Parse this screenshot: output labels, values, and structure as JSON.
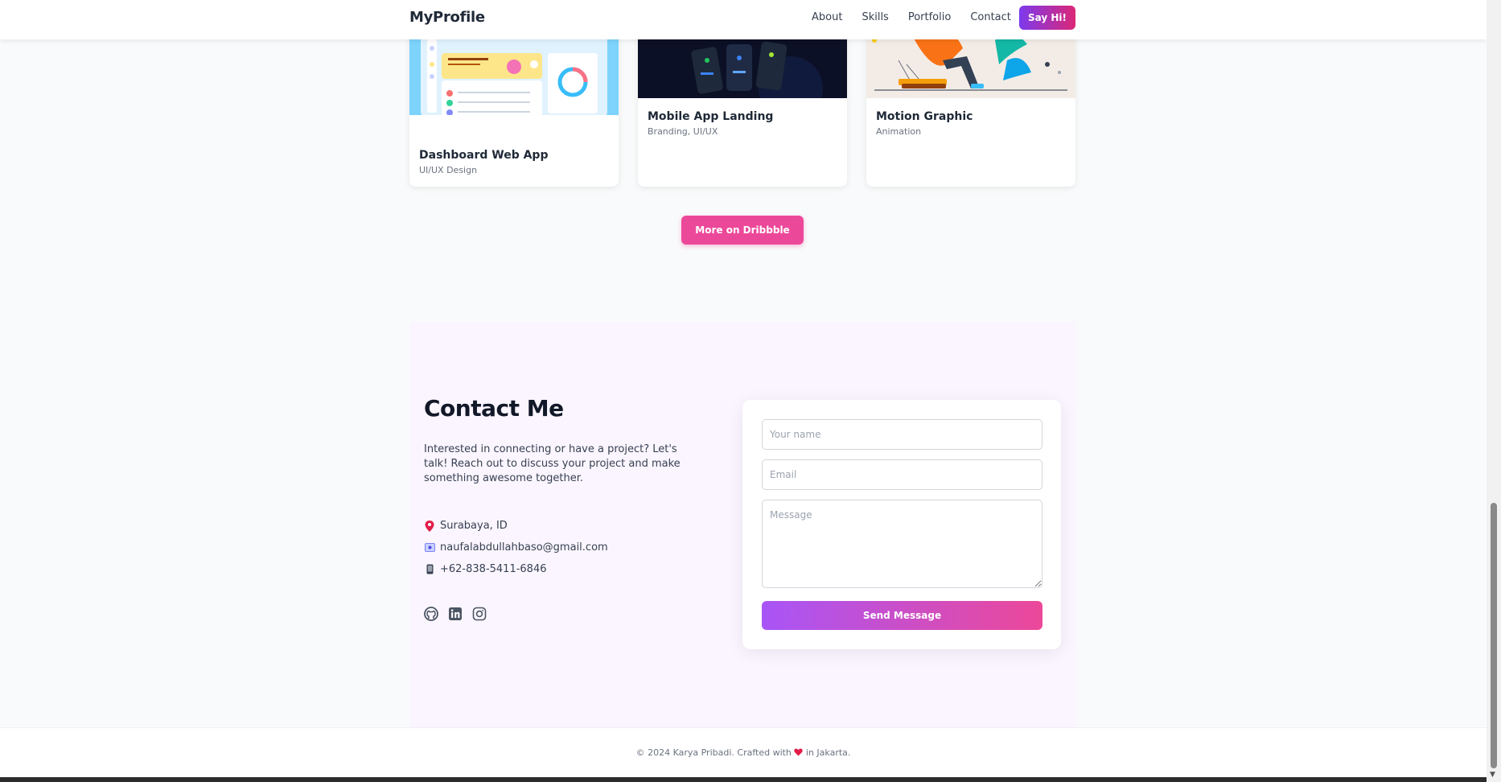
{
  "nav": {
    "brand": "MyProfile",
    "links": [
      "About",
      "Skills",
      "Portfolio",
      "Contact"
    ],
    "cta": "Say Hi!"
  },
  "portfolio": {
    "cards": [
      {
        "title": "Dashboard Web App",
        "category": "UI/UX Design"
      },
      {
        "title": "Mobile App Landing",
        "category": "Branding, UI/UX"
      },
      {
        "title": "Motion Graphic",
        "category": "Animation"
      }
    ],
    "more_label": "More on Dribbble"
  },
  "contact": {
    "title": "Contact Me",
    "description": "Interested in connecting or have a project? Let's talk! Reach out to discuss your project and make something awesome together.",
    "location": "Surabaya, ID",
    "email": "naufalabdullahbaso@gmail.com",
    "phone": "+62-838-5411-6846",
    "socials": [
      "github-icon",
      "linkedin-icon",
      "instagram-icon"
    ],
    "form": {
      "name_placeholder": "Your name",
      "email_placeholder": "Email",
      "message_placeholder": "Message",
      "submit_label": "Send Message"
    }
  },
  "footer": {
    "prefix": "© 2024 Karya Pribadi. Crafted with",
    "suffix": "in Jakarta."
  },
  "colors": {
    "accent_pink": "#ec4899",
    "accent_purple": "#7c3aed",
    "contact_bg": "#faf5ff"
  }
}
